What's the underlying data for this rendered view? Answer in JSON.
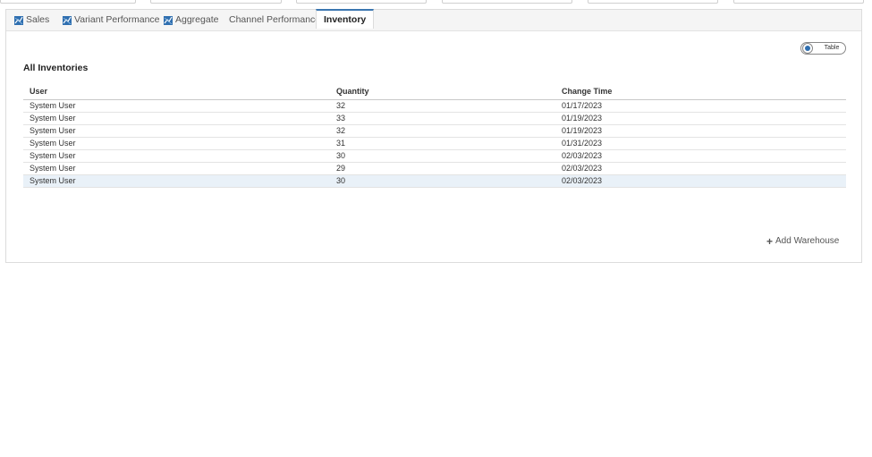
{
  "tabs": [
    {
      "label": "Sales",
      "icon": "chart-icon",
      "active": false
    },
    {
      "label": "Variant Performance",
      "icon": "chart-icon",
      "active": false
    },
    {
      "label": "Aggregate",
      "icon": "chart-icon",
      "active": false
    },
    {
      "label": "Channel Performance",
      "icon": "",
      "active": false
    },
    {
      "label": "Inventory",
      "icon": "",
      "active": true
    }
  ],
  "view_toggle": {
    "label": "Table",
    "state": "on"
  },
  "inventory": {
    "title": "All Inventories",
    "columns": [
      "User",
      "Quantity",
      "Change Time"
    ],
    "rows": [
      {
        "user": "System User",
        "quantity": "32",
        "change_time": "01/17/2023"
      },
      {
        "user": "System User",
        "quantity": "33",
        "change_time": "01/19/2023"
      },
      {
        "user": "System User",
        "quantity": "32",
        "change_time": "01/19/2023"
      },
      {
        "user": "System User",
        "quantity": "31",
        "change_time": "01/31/2023"
      },
      {
        "user": "System User",
        "quantity": "30",
        "change_time": "02/03/2023"
      },
      {
        "user": "System User",
        "quantity": "29",
        "change_time": "02/03/2023"
      },
      {
        "user": "System User",
        "quantity": "30",
        "change_time": "02/03/2023"
      }
    ],
    "highlighted_row": 6
  },
  "actions": {
    "add_warehouse": "Add Warehouse"
  },
  "colors": {
    "accent": "#3a76b0",
    "icon_blue": "#2f6fb0",
    "row_highlight": "#e9f1f8"
  }
}
